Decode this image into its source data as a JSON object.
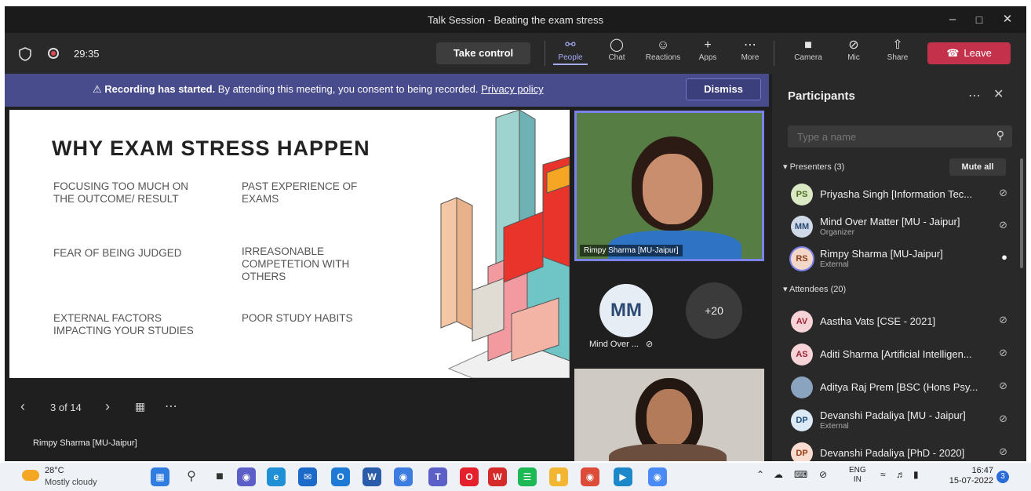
{
  "window": {
    "title": "Talk Session - Beating the exam stress"
  },
  "toolbar": {
    "timer": "29:35",
    "take_control": "Take control",
    "buttons": [
      "People",
      "Chat",
      "Reactions",
      "Apps",
      "More",
      "Camera",
      "Mic",
      "Share"
    ],
    "leave": "Leave"
  },
  "banner": {
    "bold": "Recording has started.",
    "text": "By attending this meeting, you consent to being recorded.",
    "link": "Privacy policy",
    "dismiss": "Dismiss"
  },
  "slide": {
    "title": "WHY EXAM STRESS HAPPEN",
    "items": [
      [
        "FOCUSING TOO MUCH ON",
        "THE OUTCOME/ RESULT"
      ],
      [
        "PAST EXPERIENCE OF",
        "EXAMS"
      ],
      [
        "FEAR OF BEING JUDGED"
      ],
      [
        "IRREASONABLE",
        "COMPETETION WITH",
        "OTHERS"
      ],
      [
        "EXTERNAL FACTORS",
        "IMPACTING YOUR STUDIES"
      ],
      [
        "POOR STUDY HABITS"
      ]
    ],
    "page": "3 of 14",
    "presenter": "Rimpy Sharma [MU-Jaipur]"
  },
  "stage": {
    "tile1_name": "Rimpy Sharma [MU-Jaipur]",
    "mm_initials": "MM",
    "mm_name": "Mind Over ...",
    "more_count": "+20"
  },
  "panel": {
    "title": "Participants",
    "search_placeholder": "Type a name",
    "presenters_header": "Presenters (3)",
    "mute_all": "Mute all",
    "presenters": [
      {
        "initials": "PS",
        "name": "Priyasha Singh [Information Tec...",
        "sub": "",
        "bg": "#dbe8c4",
        "fg": "#4c6b1f",
        "mic": "muted"
      },
      {
        "initials": "MM",
        "name": "Mind Over Matter [MU - Jaipur]",
        "sub": "Organizer",
        "bg": "#cfd9e8",
        "fg": "#2c4a74",
        "mic": "muted"
      },
      {
        "initials": "RS",
        "name": "Rimpy Sharma [MU-Jaipur]",
        "sub": "External",
        "bg": "#f3d8c9",
        "fg": "#8a3a1c",
        "mic": "on"
      }
    ],
    "attendees_header": "Attendees (20)",
    "attendees": [
      {
        "initials": "AV",
        "name": "Aastha Vats [CSE - 2021]",
        "sub": "",
        "bg": "#f6d3d6",
        "fg": "#9b2335"
      },
      {
        "initials": "AS",
        "name": "Aditi Sharma [Artificial Intelligen...",
        "sub": "",
        "bg": "#f6d3d6",
        "fg": "#9b2335"
      },
      {
        "initials": "",
        "name": "Aditya Raj Prem [BSC (Hons Psy...",
        "sub": "",
        "bg": "#8aa4bf",
        "fg": "#ffffff"
      },
      {
        "initials": "DP",
        "name": "Devanshi Padaliya [MU - Jaipur]",
        "sub": "External",
        "bg": "#dce9f6",
        "fg": "#1f4f82"
      },
      {
        "initials": "DP",
        "name": "Devanshi Padaliya [PhD - 2020]",
        "sub": "",
        "bg": "#f8dccf",
        "fg": "#9a3d12"
      }
    ]
  },
  "taskbar": {
    "temp": "28°C",
    "weather": "Mostly cloudy",
    "lang1": "ENG",
    "lang2": "IN",
    "time": "16:47",
    "date": "15-07-2022",
    "badge": "3"
  }
}
